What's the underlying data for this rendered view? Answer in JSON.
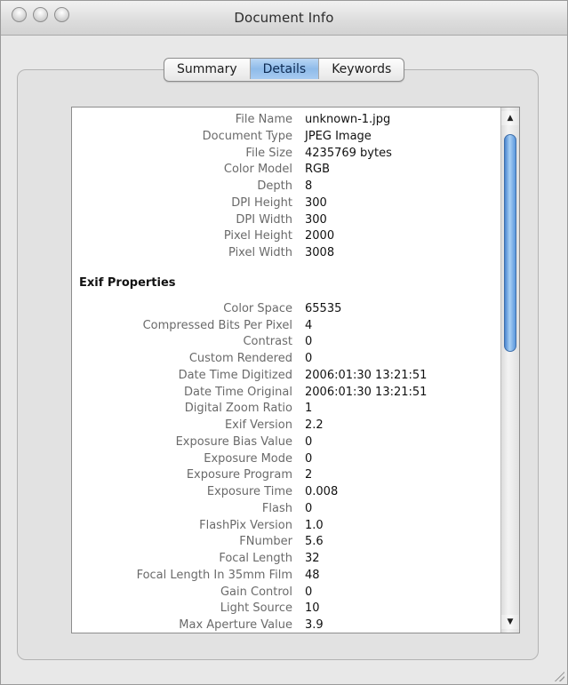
{
  "window": {
    "title": "Document Info"
  },
  "tabs": [
    {
      "label": "Summary",
      "active": false
    },
    {
      "label": "Details",
      "active": true
    },
    {
      "label": "Keywords",
      "active": false
    }
  ],
  "details": [
    {
      "label": "File Name",
      "value": "unknown-1.jpg"
    },
    {
      "label": "Document Type",
      "value": "JPEG Image"
    },
    {
      "label": "File Size",
      "value": "4235769 bytes"
    },
    {
      "label": "Color Model",
      "value": "RGB"
    },
    {
      "label": "Depth",
      "value": "8"
    },
    {
      "label": "DPI Height",
      "value": "300"
    },
    {
      "label": "DPI Width",
      "value": "300"
    },
    {
      "label": "Pixel Height",
      "value": "2000"
    },
    {
      "label": "Pixel Width",
      "value": "3008"
    }
  ],
  "exif": {
    "heading": "Exif Properties",
    "rows": [
      {
        "label": "Color Space",
        "value": "65535"
      },
      {
        "label": "Compressed Bits Per Pixel",
        "value": "4"
      },
      {
        "label": "Contrast",
        "value": "0"
      },
      {
        "label": "Custom Rendered",
        "value": "0"
      },
      {
        "label": "Date Time Digitized",
        "value": "2006:01:30 13:21:51"
      },
      {
        "label": "Date Time Original",
        "value": "2006:01:30 13:21:51"
      },
      {
        "label": "Digital Zoom Ratio",
        "value": "1"
      },
      {
        "label": "Exif Version",
        "value": "2.2"
      },
      {
        "label": "Exposure Bias Value",
        "value": "0"
      },
      {
        "label": "Exposure Mode",
        "value": "0"
      },
      {
        "label": "Exposure Program",
        "value": "2"
      },
      {
        "label": "Exposure Time",
        "value": "0.008"
      },
      {
        "label": "Flash",
        "value": "0"
      },
      {
        "label": "FlashPix Version",
        "value": "1.0"
      },
      {
        "label": "FNumber",
        "value": "5.6"
      },
      {
        "label": "Focal Length",
        "value": "32"
      },
      {
        "label": "Focal Length In 35mm Film",
        "value": "48"
      },
      {
        "label": "Gain Control",
        "value": "0"
      },
      {
        "label": "Light Source",
        "value": "10"
      },
      {
        "label": "Max Aperture Value",
        "value": "3.9"
      }
    ]
  },
  "scrollbar": {
    "up_icon": "▲",
    "down_icon": "▼",
    "position": 0.0
  }
}
